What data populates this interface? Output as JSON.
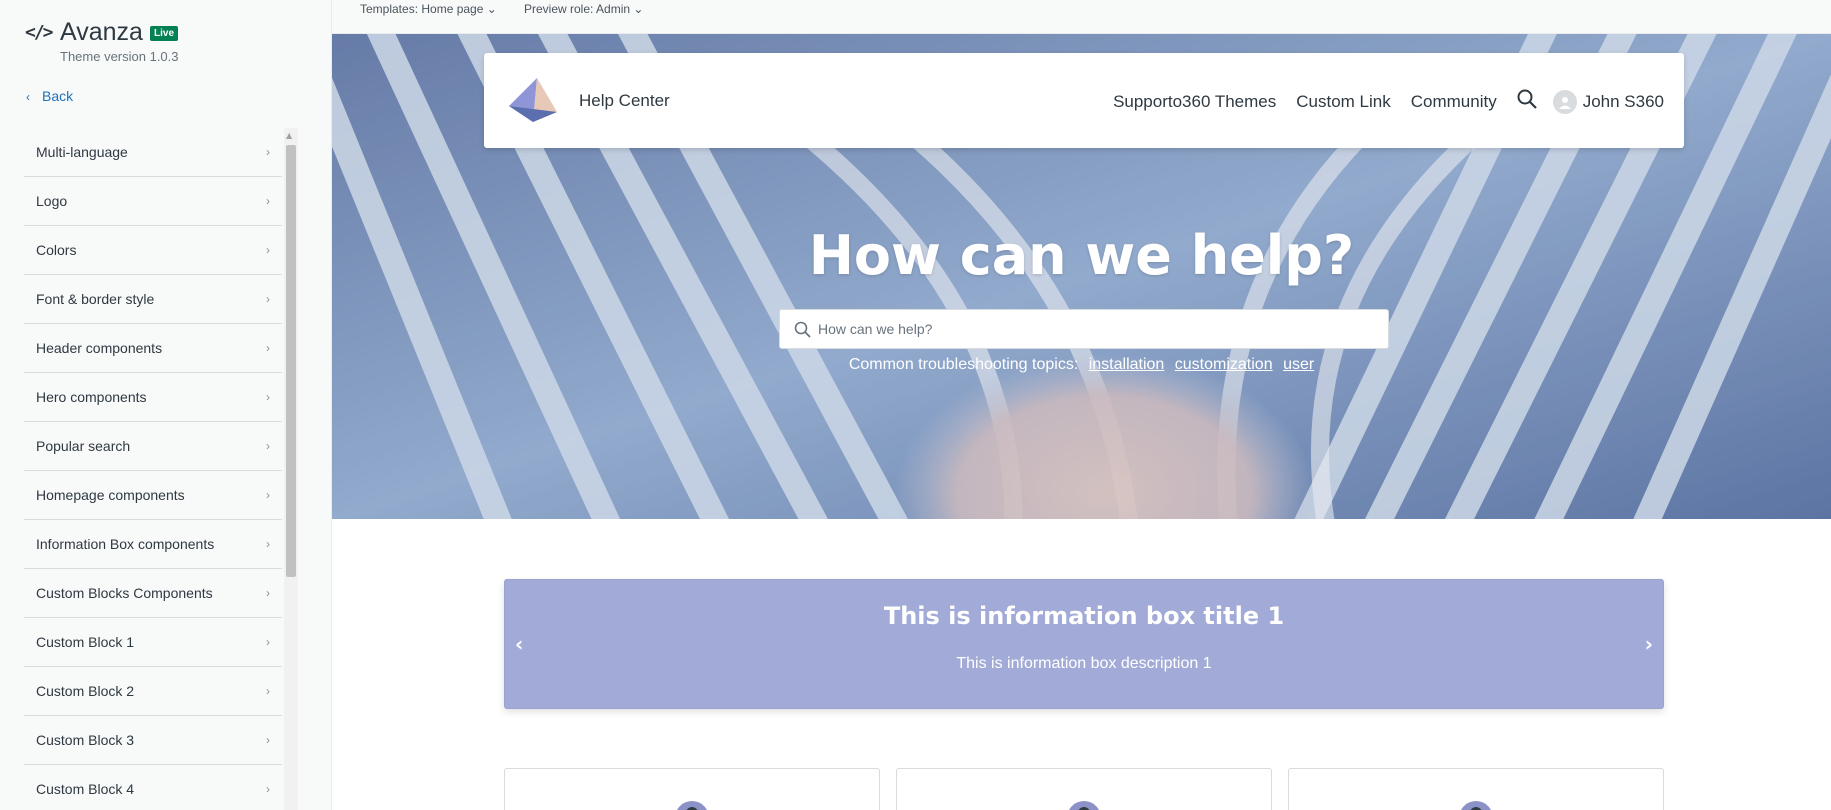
{
  "sidebar": {
    "brand_icon": "</>",
    "brand_title": "Avanza",
    "live_badge": "Live",
    "theme_version": "Theme version 1.0.3",
    "back_label": "Back",
    "items": [
      {
        "label": "Multi-language"
      },
      {
        "label": "Logo"
      },
      {
        "label": "Colors"
      },
      {
        "label": "Font & border style"
      },
      {
        "label": "Header components"
      },
      {
        "label": "Hero components"
      },
      {
        "label": "Popular search"
      },
      {
        "label": "Homepage components"
      },
      {
        "label": "Information Box components"
      },
      {
        "label": "Custom Blocks Components"
      },
      {
        "label": "Custom Block 1"
      },
      {
        "label": "Custom Block 2"
      },
      {
        "label": "Custom Block 3"
      },
      {
        "label": "Custom Block 4"
      }
    ]
  },
  "toolbar": {
    "templates": "Templates: Home page",
    "preview_role": "Preview role: Admin"
  },
  "header": {
    "title": "Help Center",
    "nav": {
      "themes": "Supporto360 Themes",
      "custom_link": "Custom Link",
      "community": "Community",
      "user_name": "John S360"
    }
  },
  "hero": {
    "title": "How can we help?",
    "search_placeholder": "How can we help?",
    "topics_label": "Common troubleshooting topics:",
    "topics": [
      "installation",
      "customization",
      "user"
    ]
  },
  "info_box": {
    "title": "This is information box title 1",
    "description": "This is information box description 1",
    "prev": "‹",
    "next": "›"
  },
  "colors": {
    "accent_green": "#038153",
    "info_box_bg": "#a2abd7",
    "link_blue": "#1f73b7"
  }
}
